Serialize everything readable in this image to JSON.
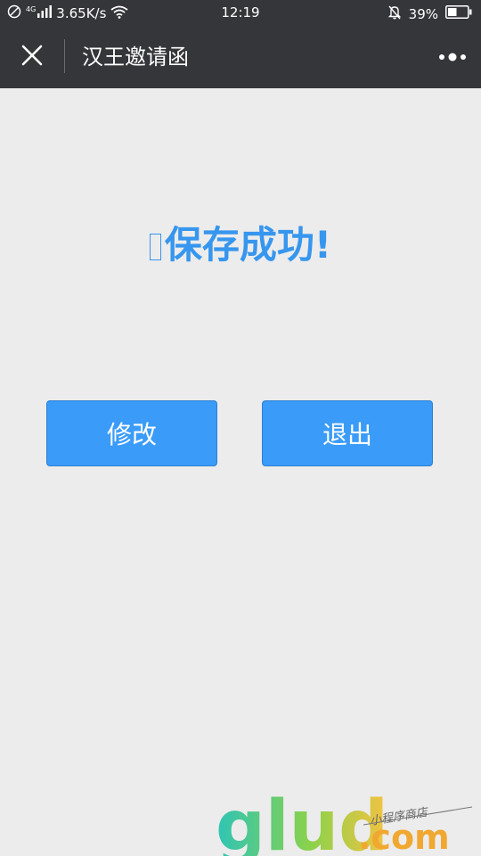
{
  "status_bar": {
    "network_type": "4G",
    "speed": "3.65K/s",
    "time": "12:19",
    "battery": "39%"
  },
  "nav": {
    "title": "汉王邀请函"
  },
  "content": {
    "message": "保存成功!",
    "edit_label": "修改",
    "exit_label": "退出"
  },
  "watermark": {
    "logo_text": "glud",
    "domain": ".com",
    "tagline": "小程序商店"
  },
  "colors": {
    "accent": "#3b9bf8",
    "message": "#3796ee",
    "header": "#35363a",
    "background": "#ececec"
  },
  "icons": {
    "close": "close-icon",
    "more": "more-icon"
  }
}
